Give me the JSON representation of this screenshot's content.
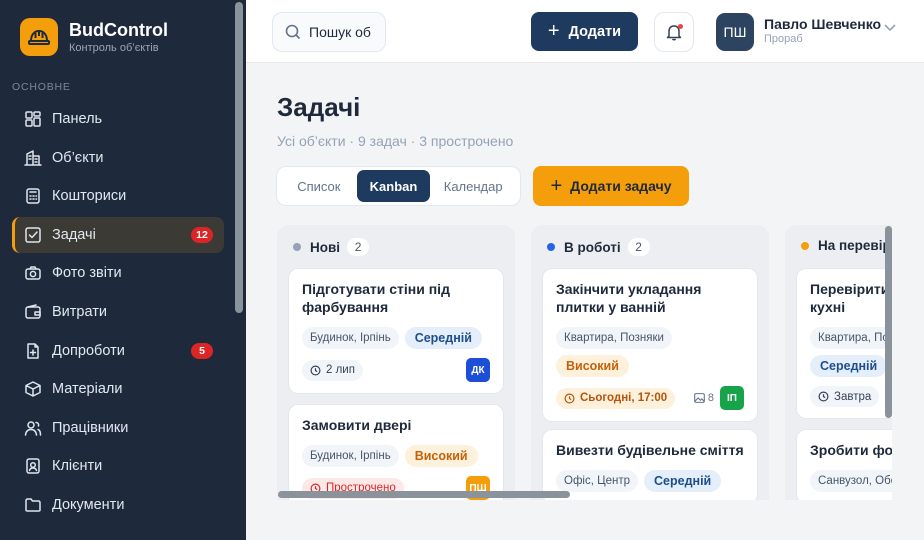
{
  "brand": {
    "name": "BudControl",
    "subtitle": "Контроль об’єктів"
  },
  "sidebar": {
    "section": "ОСНОВНЕ",
    "items": [
      {
        "label": "Панель",
        "icon": "dashboard-icon"
      },
      {
        "label": "Об’єкти",
        "icon": "building-icon"
      },
      {
        "label": "Кошториси",
        "icon": "calculator-icon"
      },
      {
        "label": "Задачі",
        "icon": "checkbox-icon",
        "badge": "12",
        "active": true
      },
      {
        "label": "Фото звіти",
        "icon": "camera-icon"
      },
      {
        "label": "Витрати",
        "icon": "wallet-icon"
      },
      {
        "label": "Допроботи",
        "icon": "document-plus-icon",
        "badge": "5"
      },
      {
        "label": "Матеріали",
        "icon": "box-icon"
      },
      {
        "label": "Працівники",
        "icon": "users-icon"
      },
      {
        "label": "Клієнти",
        "icon": "contact-icon"
      },
      {
        "label": "Документи",
        "icon": "folder-icon"
      }
    ]
  },
  "header": {
    "search_placeholder": "Пошук об",
    "add_label": "Додати",
    "user": {
      "initials": "ПШ",
      "name": "Павло Шевченко",
      "role": "Прораб"
    }
  },
  "page": {
    "title": "Задачі",
    "subtitle": "Усі об’єкти · 9 задач · 3 прострочено",
    "views": [
      "Список",
      "Kanban",
      "Календар"
    ],
    "active_view": "Kanban",
    "add_task_label": "Додати задачу"
  },
  "columns": [
    {
      "title": "Нові",
      "count": "2",
      "dot_color": "#94a3b8",
      "cards": [
        {
          "title": "Підготувати стіни під фарбування",
          "object": "Будинок, Ірпінь",
          "priority": "Середній",
          "priority_type": "mid",
          "date": "2 лип",
          "date_type": "normal",
          "assignee": "ДК",
          "assignee_color": "#1d4ed8"
        },
        {
          "title": "Замовити двері",
          "object": "Будинок, Ірпінь",
          "priority": "Високий",
          "priority_type": "high",
          "date": "Прострочено",
          "date_type": "overdue",
          "assignee": "ПШ",
          "assignee_color": "#f59e0b"
        }
      ]
    },
    {
      "title": "В роботі",
      "count": "2",
      "dot_color": "#2563eb",
      "cards": [
        {
          "title": "Закінчити укладання плитки у ванній",
          "object": "Квартира, Позняки",
          "priority": "Високий",
          "priority_type": "high",
          "date": "Сьогодні, 17:00",
          "date_type": "today",
          "photos": "8",
          "assignee": "ІП",
          "assignee_color": "#16a34a"
        },
        {
          "title": "Вивезти будівельне сміття",
          "object": "Офіс, Центр",
          "priority": "Середній",
          "priority_type": "mid"
        }
      ]
    },
    {
      "title": "На перевірці",
      "dot_color": "#f59e0b",
      "cards": [
        {
          "title": "Перевірити електрику кухні",
          "object": "Квартира, Позняки",
          "priority": "Середній",
          "priority_type": "mid",
          "date": "Завтра",
          "date_type": "normal"
        },
        {
          "title": "Зробити фото робіт",
          "object": "Санвузол, Оболонь"
        }
      ]
    }
  ]
}
